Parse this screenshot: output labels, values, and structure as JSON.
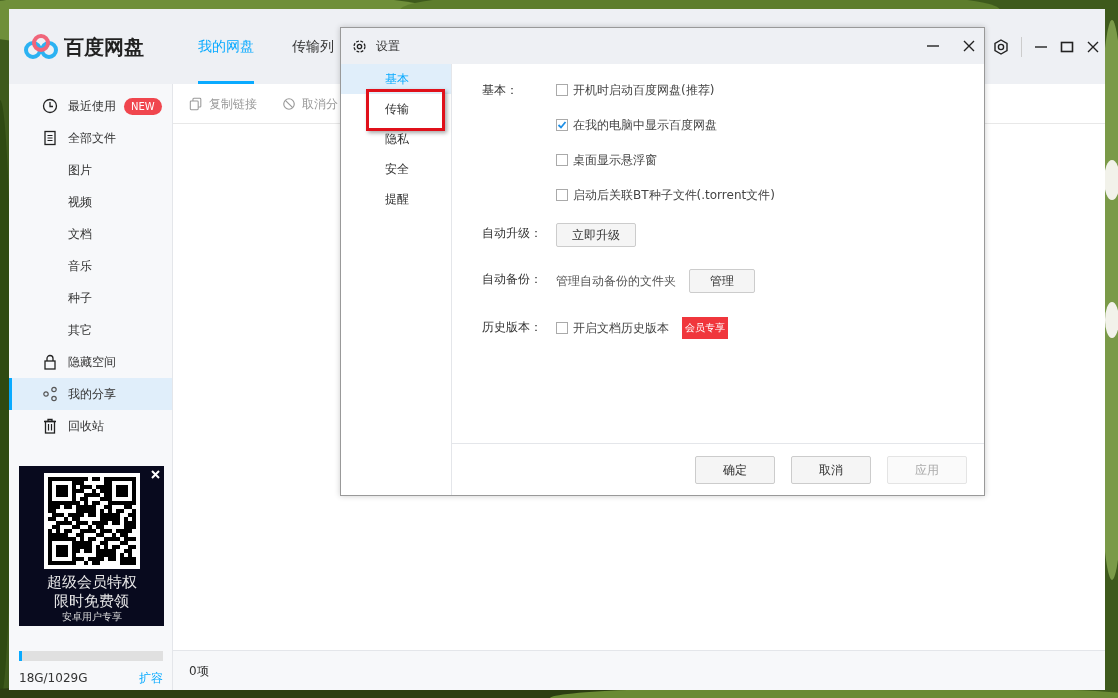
{
  "app": {
    "logo_text": "百度网盘",
    "tabs": [
      {
        "label": "我的网盘",
        "selected": true
      },
      {
        "label": "传输列",
        "selected": false
      }
    ]
  },
  "sidebar": {
    "items": [
      {
        "kind": "clock",
        "label": "最近使用",
        "badge": "NEW",
        "selected": false
      },
      {
        "kind": "file",
        "label": "全部文件",
        "selected": false,
        "children": [
          {
            "label": "图片",
            "selected": false
          },
          {
            "label": "视频",
            "selected": false
          },
          {
            "label": "文档",
            "selected": false
          },
          {
            "label": "音乐",
            "selected": false
          },
          {
            "label": "种子",
            "selected": false
          },
          {
            "label": "其它",
            "selected": false
          }
        ]
      },
      {
        "kind": "lock",
        "label": "隐藏空间",
        "selected": false
      },
      {
        "kind": "share",
        "label": "我的分享",
        "selected": true
      },
      {
        "kind": "trash",
        "label": "回收站",
        "selected": false
      }
    ]
  },
  "ad": {
    "lines": [
      "超级会员特权",
      "限时免费领",
      "安卓用户专享"
    ]
  },
  "storage": {
    "level": 0.0175,
    "usage": "18G/1029G",
    "expand": "扩容"
  },
  "toolbar": [
    {
      "kind": "copy",
      "label": "复制链接",
      "disabled": true
    },
    {
      "kind": "cancel",
      "label": "取消分",
      "disabled": true
    }
  ],
  "status_bar": {
    "count": "0项"
  },
  "dialog": {
    "title": "设置",
    "nav": [
      {
        "label": "基本",
        "selected": true,
        "highlighted": false
      },
      {
        "label": "传输",
        "selected": false,
        "highlighted": true
      },
      {
        "label": "隐私",
        "selected": false,
        "highlighted": false
      },
      {
        "label": "安全",
        "selected": false,
        "highlighted": false
      },
      {
        "label": "提醒",
        "selected": false,
        "highlighted": false
      }
    ],
    "sections": [
      {
        "kind": "checks",
        "label": "基本：",
        "options": [
          {
            "label": "开机时启动百度网盘(推荐)",
            "checked": false
          },
          {
            "label": "在我的电脑中显示百度网盘",
            "checked": true
          },
          {
            "label": "桌面显示悬浮窗",
            "checked": false
          },
          {
            "label": "启动后关联BT种子文件(.torrent文件)",
            "checked": false
          }
        ]
      },
      {
        "kind": "button",
        "label": "自动升级：",
        "button": "立即升级"
      },
      {
        "kind": "text_button",
        "label": "自动备份：",
        "text": "管理自动备份的文件夹",
        "button": "管理"
      },
      {
        "kind": "checks",
        "label": "历史版本：",
        "options": [
          {
            "label": "开启文档历史版本",
            "checked": false,
            "badge": "会员专享"
          }
        ]
      }
    ],
    "buttons": [
      {
        "label": "确定",
        "disabled": false
      },
      {
        "label": "取消",
        "disabled": false
      },
      {
        "label": "应用",
        "disabled": true
      }
    ]
  }
}
